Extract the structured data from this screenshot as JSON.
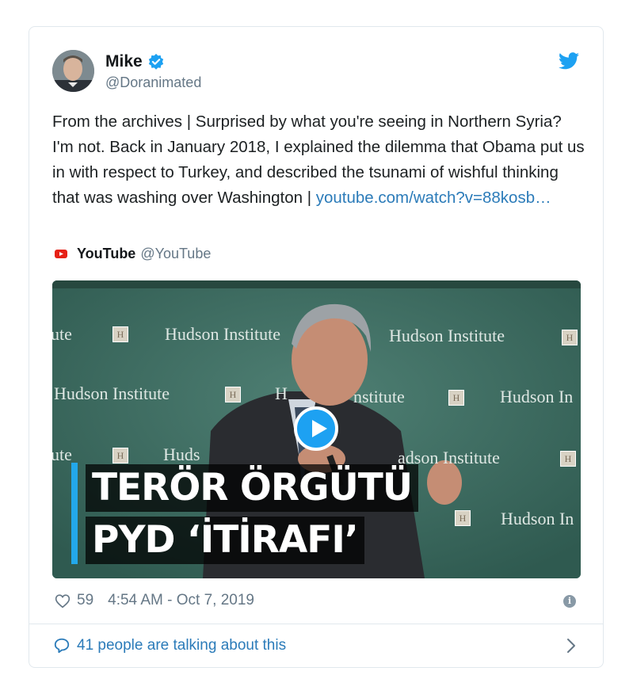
{
  "author": {
    "name": "Mike",
    "handle": "@Doranimated"
  },
  "tweet": {
    "text": "From the archives | Surprised by what you're seeing in Northern Syria? I'm not. Back in January 2018, I explained the dilemma that Obama put us in with respect to Turkey, and described the tsunami of wishful thinking that was washing over Washington |",
    "link": "youtube.com/watch?v=88kosb…"
  },
  "source": {
    "name": "YouTube",
    "handle": "@YouTube"
  },
  "media": {
    "headline_line1": "TERÖR ÖRGÜTÜ",
    "headline_line2": "PYD ‘İTİRAFI’",
    "watermark_texts": [
      "ute",
      "Hudson Institute",
      "Hudson Institute",
      "Hudson Institute",
      "H",
      "nstitute",
      "Hudson In",
      "ute",
      "Huds",
      "adson Institute",
      "Hudson In",
      "H son Institute"
    ]
  },
  "meta": {
    "likes": "59",
    "timestamp": "4:54 AM - Oct 7, 2019"
  },
  "footer": {
    "talking": "41 people are talking about this"
  },
  "colors": {
    "twitter_blue": "#1da1f2",
    "link_blue": "#2b7bb9",
    "muted": "#657786",
    "headline_bar": "#23a8ea"
  },
  "icons": [
    "verified-badge-icon",
    "twitter-bird-icon",
    "youtube-logo-icon",
    "play-icon",
    "heart-icon",
    "info-icon",
    "speech-bubble-icon",
    "chevron-right-icon"
  ]
}
